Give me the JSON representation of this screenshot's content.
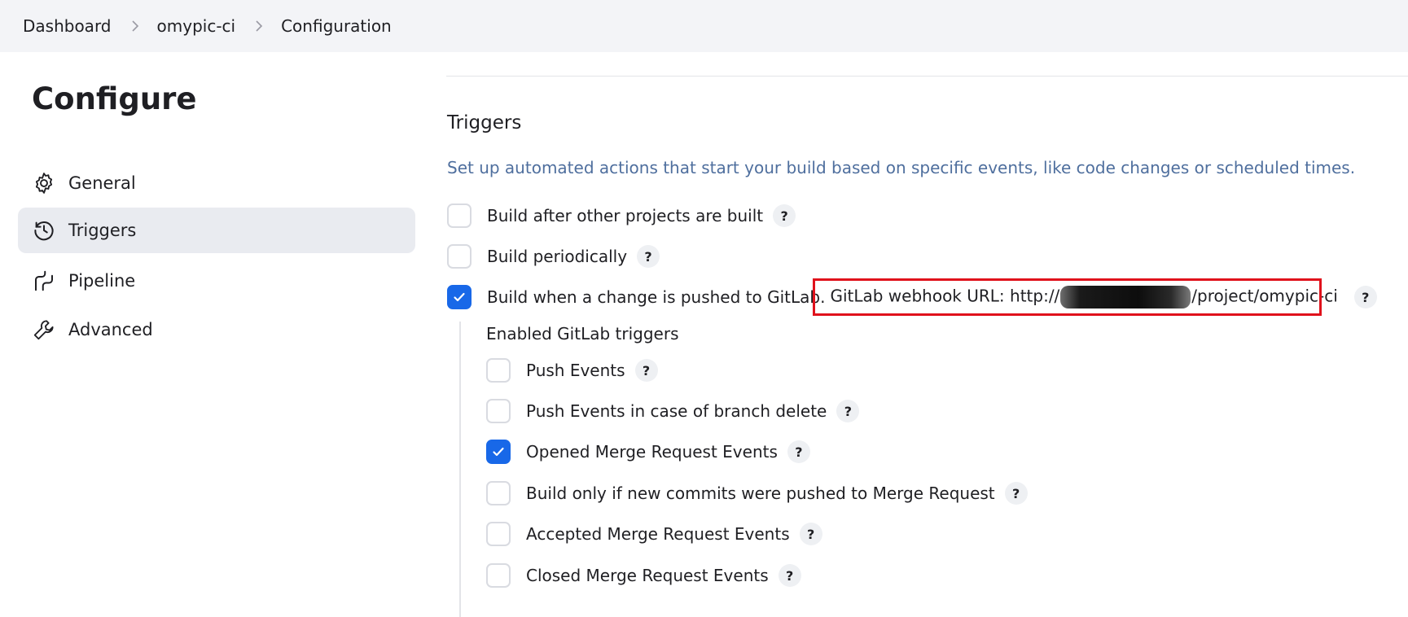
{
  "breadcrumb": {
    "items": [
      "Dashboard",
      "omypic-ci",
      "Configuration"
    ]
  },
  "sidebar": {
    "title": "Configure",
    "items": [
      {
        "label": "General",
        "icon": "gear-icon",
        "active": false
      },
      {
        "label": "Triggers",
        "icon": "clock-icon",
        "active": true
      },
      {
        "label": "Pipeline",
        "icon": "pipeline-icon",
        "active": false
      },
      {
        "label": "Advanced",
        "icon": "wrench-icon",
        "active": false
      }
    ]
  },
  "triggers": {
    "title": "Triggers",
    "description": "Set up automated actions that start your build based on specific events, like code changes or scheduled times.",
    "options": [
      {
        "label": "Build after other projects are built",
        "checked": false
      },
      {
        "label": "Build periodically",
        "checked": false
      },
      {
        "label": "Build when a change is pushed to GitLab.",
        "checked": true
      }
    ],
    "webhook": {
      "prefix": "GitLab webhook URL: http://",
      "suffix": "/project/omypic-ci"
    },
    "gitlab_group_title": "Enabled GitLab triggers",
    "gitlab_options": [
      {
        "label": "Push Events",
        "checked": false
      },
      {
        "label": "Push Events in case of branch delete",
        "checked": false
      },
      {
        "label": "Opened Merge Request Events",
        "checked": true
      },
      {
        "label": "Build only if new commits were pushed to Merge Request",
        "checked": false
      },
      {
        "label": "Accepted Merge Request Events",
        "checked": false
      },
      {
        "label": "Closed Merge Request Events",
        "checked": false
      }
    ],
    "help_glyph": "?"
  },
  "colors": {
    "accent": "#1868e8",
    "highlight_box": "#e0121c",
    "description_text": "#4f6f9e"
  }
}
